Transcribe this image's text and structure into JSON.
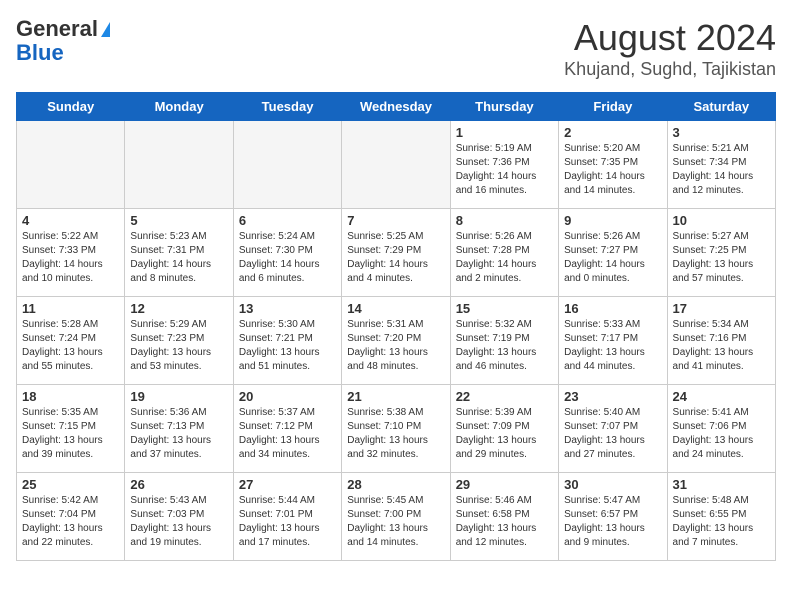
{
  "logo": {
    "general": "General",
    "blue": "Blue"
  },
  "title": "August 2024",
  "location": "Khujand, Sughd, Tajikistan",
  "days_of_week": [
    "Sunday",
    "Monday",
    "Tuesday",
    "Wednesday",
    "Thursday",
    "Friday",
    "Saturday"
  ],
  "weeks": [
    [
      {
        "day": "",
        "info": ""
      },
      {
        "day": "",
        "info": ""
      },
      {
        "day": "",
        "info": ""
      },
      {
        "day": "",
        "info": ""
      },
      {
        "day": "1",
        "info": "Sunrise: 5:19 AM\nSunset: 7:36 PM\nDaylight: 14 hours\nand 16 minutes."
      },
      {
        "day": "2",
        "info": "Sunrise: 5:20 AM\nSunset: 7:35 PM\nDaylight: 14 hours\nand 14 minutes."
      },
      {
        "day": "3",
        "info": "Sunrise: 5:21 AM\nSunset: 7:34 PM\nDaylight: 14 hours\nand 12 minutes."
      }
    ],
    [
      {
        "day": "4",
        "info": "Sunrise: 5:22 AM\nSunset: 7:33 PM\nDaylight: 14 hours\nand 10 minutes."
      },
      {
        "day": "5",
        "info": "Sunrise: 5:23 AM\nSunset: 7:31 PM\nDaylight: 14 hours\nand 8 minutes."
      },
      {
        "day": "6",
        "info": "Sunrise: 5:24 AM\nSunset: 7:30 PM\nDaylight: 14 hours\nand 6 minutes."
      },
      {
        "day": "7",
        "info": "Sunrise: 5:25 AM\nSunset: 7:29 PM\nDaylight: 14 hours\nand 4 minutes."
      },
      {
        "day": "8",
        "info": "Sunrise: 5:26 AM\nSunset: 7:28 PM\nDaylight: 14 hours\nand 2 minutes."
      },
      {
        "day": "9",
        "info": "Sunrise: 5:26 AM\nSunset: 7:27 PM\nDaylight: 14 hours\nand 0 minutes."
      },
      {
        "day": "10",
        "info": "Sunrise: 5:27 AM\nSunset: 7:25 PM\nDaylight: 13 hours\nand 57 minutes."
      }
    ],
    [
      {
        "day": "11",
        "info": "Sunrise: 5:28 AM\nSunset: 7:24 PM\nDaylight: 13 hours\nand 55 minutes."
      },
      {
        "day": "12",
        "info": "Sunrise: 5:29 AM\nSunset: 7:23 PM\nDaylight: 13 hours\nand 53 minutes."
      },
      {
        "day": "13",
        "info": "Sunrise: 5:30 AM\nSunset: 7:21 PM\nDaylight: 13 hours\nand 51 minutes."
      },
      {
        "day": "14",
        "info": "Sunrise: 5:31 AM\nSunset: 7:20 PM\nDaylight: 13 hours\nand 48 minutes."
      },
      {
        "day": "15",
        "info": "Sunrise: 5:32 AM\nSunset: 7:19 PM\nDaylight: 13 hours\nand 46 minutes."
      },
      {
        "day": "16",
        "info": "Sunrise: 5:33 AM\nSunset: 7:17 PM\nDaylight: 13 hours\nand 44 minutes."
      },
      {
        "day": "17",
        "info": "Sunrise: 5:34 AM\nSunset: 7:16 PM\nDaylight: 13 hours\nand 41 minutes."
      }
    ],
    [
      {
        "day": "18",
        "info": "Sunrise: 5:35 AM\nSunset: 7:15 PM\nDaylight: 13 hours\nand 39 minutes."
      },
      {
        "day": "19",
        "info": "Sunrise: 5:36 AM\nSunset: 7:13 PM\nDaylight: 13 hours\nand 37 minutes."
      },
      {
        "day": "20",
        "info": "Sunrise: 5:37 AM\nSunset: 7:12 PM\nDaylight: 13 hours\nand 34 minutes."
      },
      {
        "day": "21",
        "info": "Sunrise: 5:38 AM\nSunset: 7:10 PM\nDaylight: 13 hours\nand 32 minutes."
      },
      {
        "day": "22",
        "info": "Sunrise: 5:39 AM\nSunset: 7:09 PM\nDaylight: 13 hours\nand 29 minutes."
      },
      {
        "day": "23",
        "info": "Sunrise: 5:40 AM\nSunset: 7:07 PM\nDaylight: 13 hours\nand 27 minutes."
      },
      {
        "day": "24",
        "info": "Sunrise: 5:41 AM\nSunset: 7:06 PM\nDaylight: 13 hours\nand 24 minutes."
      }
    ],
    [
      {
        "day": "25",
        "info": "Sunrise: 5:42 AM\nSunset: 7:04 PM\nDaylight: 13 hours\nand 22 minutes."
      },
      {
        "day": "26",
        "info": "Sunrise: 5:43 AM\nSunset: 7:03 PM\nDaylight: 13 hours\nand 19 minutes."
      },
      {
        "day": "27",
        "info": "Sunrise: 5:44 AM\nSunset: 7:01 PM\nDaylight: 13 hours\nand 17 minutes."
      },
      {
        "day": "28",
        "info": "Sunrise: 5:45 AM\nSunset: 7:00 PM\nDaylight: 13 hours\nand 14 minutes."
      },
      {
        "day": "29",
        "info": "Sunrise: 5:46 AM\nSunset: 6:58 PM\nDaylight: 13 hours\nand 12 minutes."
      },
      {
        "day": "30",
        "info": "Sunrise: 5:47 AM\nSunset: 6:57 PM\nDaylight: 13 hours\nand 9 minutes."
      },
      {
        "day": "31",
        "info": "Sunrise: 5:48 AM\nSunset: 6:55 PM\nDaylight: 13 hours\nand 7 minutes."
      }
    ]
  ]
}
